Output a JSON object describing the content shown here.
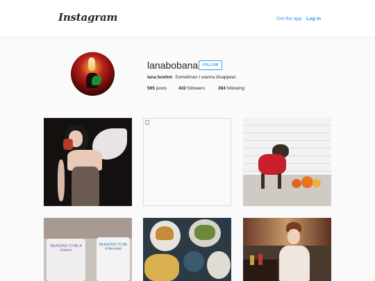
{
  "header": {
    "logo": "Instagram",
    "get_app": "Get the app",
    "login": "Log in"
  },
  "profile": {
    "username": "lanabobana",
    "follow_label": "FOLLOW",
    "full_name": "lana boehm",
    "bio": "Sometimes I wanna disappear.",
    "posts_count": "565",
    "posts_label": "posts",
    "followers_count": "432",
    "followers_label": "followers",
    "following_count": "284",
    "following_label": "following"
  },
  "colors": {
    "accent": "#3897f0",
    "background": "#fafafa",
    "text": "#262626"
  },
  "grid": {
    "tiles": [
      {
        "subject": "woman in lingerie with angel wings holding drink"
      },
      {
        "subject": "broken image placeholder"
      },
      {
        "subject": "dog in red sweater with pumpkins"
      },
      {
        "subject": "two unicorn and mermaid mugs"
      },
      {
        "subject": "burgers and fries on blue plates"
      },
      {
        "subject": "woman at bar counter"
      }
    ],
    "mug1_text": "REASONS TO BE A Unicorn",
    "mug2_text": "REASONS TO BE A Mermaid"
  }
}
